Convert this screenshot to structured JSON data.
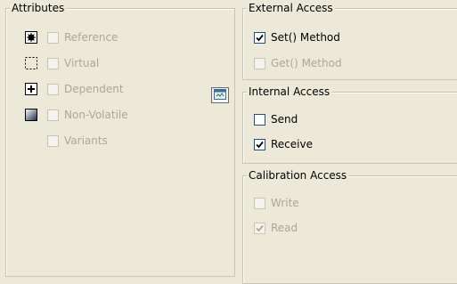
{
  "attributes": {
    "legend": "Attributes",
    "items": [
      {
        "label": "Reference",
        "checked": false,
        "enabled": false,
        "icon": "reference-icon"
      },
      {
        "label": "Virtual",
        "checked": false,
        "enabled": false,
        "icon": "virtual-icon"
      },
      {
        "label": "Dependent",
        "checked": false,
        "enabled": false,
        "icon": "dependent-icon"
      },
      {
        "label": "Non-Volatile",
        "checked": false,
        "enabled": false,
        "icon": "non-volatile-icon"
      },
      {
        "label": "Variants",
        "checked": false,
        "enabled": false,
        "icon": null
      }
    ],
    "dependent_button_icon": "formula-editor-icon"
  },
  "external_access": {
    "legend": "External Access",
    "items": [
      {
        "label": "Set() Method",
        "checked": true,
        "enabled": true
      },
      {
        "label": "Get() Method",
        "checked": false,
        "enabled": false
      }
    ]
  },
  "internal_access": {
    "legend": "Internal Access",
    "items": [
      {
        "label": "Send",
        "checked": false,
        "enabled": true
      },
      {
        "label": "Receive",
        "checked": true,
        "enabled": true
      }
    ]
  },
  "calibration_access": {
    "legend": "Calibration Access",
    "items": [
      {
        "label": "Write",
        "checked": false,
        "enabled": false
      },
      {
        "label": "Read",
        "checked": true,
        "enabled": false
      }
    ]
  },
  "colors": {
    "background": "#ece9d8",
    "disabled_text": "#aca899",
    "checkbox_border": "#1c5180",
    "check_mark": "#21a121"
  }
}
